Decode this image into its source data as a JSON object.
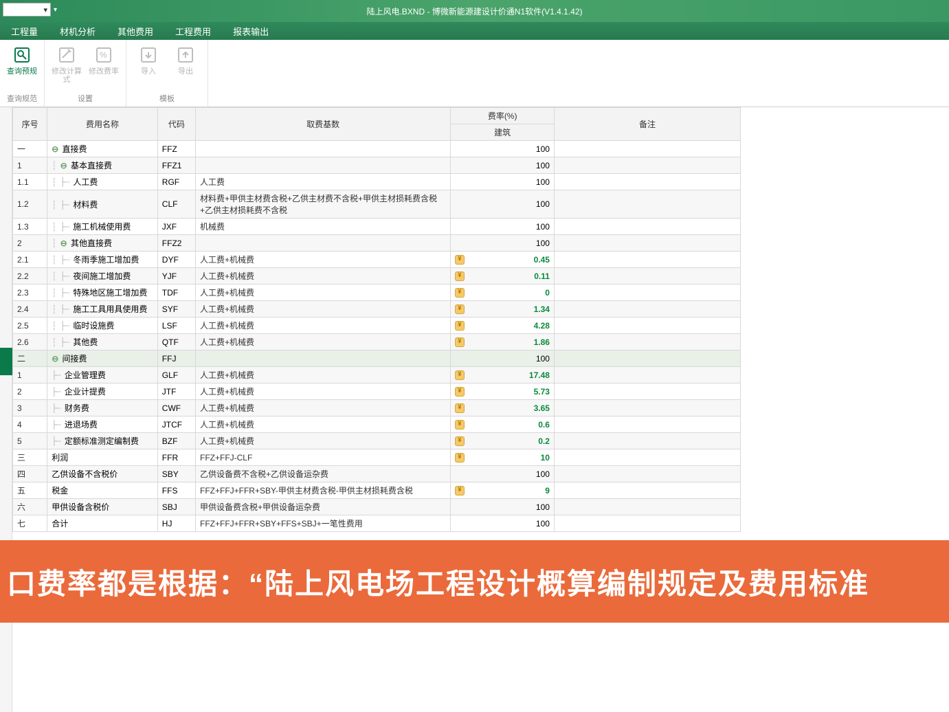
{
  "app_title": "陆上风电.BXND - 博微新能源建设计价通N1软件(V1.4.1.42)",
  "qat_dropdown": "",
  "menu": {
    "items": [
      "工程量",
      "材机分析",
      "其他费用",
      "工程费用",
      "报表输出"
    ]
  },
  "ribbon": {
    "groups": [
      {
        "label": "查询规范",
        "buttons": [
          {
            "label": "查询预规",
            "icon": "doc-search",
            "enabled": true
          }
        ]
      },
      {
        "label": "设置",
        "buttons": [
          {
            "label": "修改计算式",
            "icon": "edit-formula",
            "enabled": false
          },
          {
            "label": "修改费率",
            "icon": "edit-pct",
            "enabled": false
          }
        ]
      },
      {
        "label": "模板",
        "buttons": [
          {
            "label": "导入",
            "icon": "folder-in",
            "enabled": false
          },
          {
            "label": "导出",
            "icon": "folder-out",
            "enabled": false
          }
        ]
      }
    ]
  },
  "grid": {
    "headers": {
      "seq": "序号",
      "name": "费用名称",
      "code": "代码",
      "base": "取费基数",
      "rate_group": "费率(%)",
      "rate_sub": "建筑",
      "remark": "备注"
    },
    "rows": [
      {
        "seq": "一",
        "name": "直接费",
        "code": "FFZ",
        "base": "",
        "rate": "100",
        "badge": false,
        "green": false,
        "indent": 0,
        "toggle": true
      },
      {
        "seq": "1",
        "name": "基本直接费",
        "code": "FFZ1",
        "base": "",
        "rate": "100",
        "badge": false,
        "green": false,
        "indent": 1,
        "toggle": true,
        "alt": true
      },
      {
        "seq": "1.1",
        "name": "人工费",
        "code": "RGF",
        "base": "人工费",
        "rate": "100",
        "badge": false,
        "green": false,
        "indent": 2
      },
      {
        "seq": "1.2",
        "name": "材料费",
        "code": "CLF",
        "base": "材料费+甲供主材费含税+乙供主材费不含税+甲供主材损耗费含税+乙供主材损耗费不含税",
        "rate": "100",
        "badge": false,
        "green": false,
        "indent": 2,
        "tall": true,
        "alt": true
      },
      {
        "seq": "1.3",
        "name": "施工机械使用费",
        "code": "JXF",
        "base": "机械费",
        "rate": "100",
        "badge": false,
        "green": false,
        "indent": 2
      },
      {
        "seq": "2",
        "name": "其他直接费",
        "code": "FFZ2",
        "base": "",
        "rate": "100",
        "badge": false,
        "green": false,
        "indent": 1,
        "toggle": true,
        "alt": true
      },
      {
        "seq": "2.1",
        "name": "冬雨季施工增加费",
        "code": "DYF",
        "base": "人工费+机械费",
        "rate": "0.45",
        "badge": true,
        "green": true,
        "indent": 2
      },
      {
        "seq": "2.2",
        "name": "夜间施工增加费",
        "code": "YJF",
        "base": "人工费+机械费",
        "rate": "0.11",
        "badge": true,
        "green": true,
        "indent": 2,
        "alt": true
      },
      {
        "seq": "2.3",
        "name": "特殊地区施工增加费",
        "code": "TDF",
        "base": "人工费+机械费",
        "rate": "0",
        "badge": true,
        "green": true,
        "indent": 2
      },
      {
        "seq": "2.4",
        "name": "施工工具用具使用费",
        "code": "SYF",
        "base": "人工费+机械费",
        "rate": "1.34",
        "badge": true,
        "green": true,
        "indent": 2,
        "alt": true
      },
      {
        "seq": "2.5",
        "name": "临时设施费",
        "code": "LSF",
        "base": "人工费+机械费",
        "rate": "4.28",
        "badge": true,
        "green": true,
        "indent": 2
      },
      {
        "seq": "2.6",
        "name": "其他费",
        "code": "QTF",
        "base": "人工费+机械费",
        "rate": "1.86",
        "badge": true,
        "green": true,
        "indent": 2,
        "alt": true
      },
      {
        "seq": "二",
        "name": "间接费",
        "code": "FFJ",
        "base": "",
        "rate": "100",
        "badge": false,
        "green": false,
        "indent": 0,
        "toggle": true,
        "sel": true
      },
      {
        "seq": "1",
        "name": "企业管理费",
        "code": "GLF",
        "base": "人工费+机械费",
        "rate": "17.48",
        "badge": true,
        "green": true,
        "indent": 1,
        "alt": true
      },
      {
        "seq": "2",
        "name": "企业计提费",
        "code": "JTF",
        "base": "人工费+机械费",
        "rate": "5.73",
        "badge": true,
        "green": true,
        "indent": 1
      },
      {
        "seq": "3",
        "name": "财务费",
        "code": "CWF",
        "base": "人工费+机械费",
        "rate": "3.65",
        "badge": true,
        "green": true,
        "indent": 1,
        "alt": true
      },
      {
        "seq": "4",
        "name": "进退场费",
        "code": "JTCF",
        "base": "人工费+机械费",
        "rate": "0.6",
        "badge": true,
        "green": true,
        "indent": 1
      },
      {
        "seq": "5",
        "name": "定额标准测定编制费",
        "code": "BZF",
        "base": "人工费+机械费",
        "rate": "0.2",
        "badge": true,
        "green": true,
        "indent": 1,
        "alt": true
      },
      {
        "seq": "三",
        "name": "利润",
        "code": "FFR",
        "base": "FFZ+FFJ-CLF",
        "rate": "10",
        "badge": true,
        "green": true,
        "indent": 0
      },
      {
        "seq": "四",
        "name": "乙供设备不含税价",
        "code": "SBY",
        "base": "乙供设备费不含税+乙供设备运杂费",
        "rate": "100",
        "badge": false,
        "green": false,
        "indent": 0,
        "alt": true
      },
      {
        "seq": "五",
        "name": "税金",
        "code": "FFS",
        "base": "FFZ+FFJ+FFR+SBY-甲供主材费含税-甲供主材损耗费含税",
        "rate": "9",
        "badge": true,
        "green": true,
        "indent": 0
      },
      {
        "seq": "六",
        "name": "甲供设备含税价",
        "code": "SBJ",
        "base": "甲供设备费含税+甲供设备运杂费",
        "rate": "100",
        "badge": false,
        "green": false,
        "indent": 0,
        "alt": true
      },
      {
        "seq": "七",
        "name": "合计",
        "code": "HJ",
        "base": "FFZ+FFJ+FFR+SBY+FFS+SBJ+一笔性费用",
        "rate": "100",
        "badge": false,
        "green": false,
        "indent": 0
      }
    ]
  },
  "banner_text": "口费率都是根据：“陆上风电场工程设计概算编制规定及费用标准"
}
